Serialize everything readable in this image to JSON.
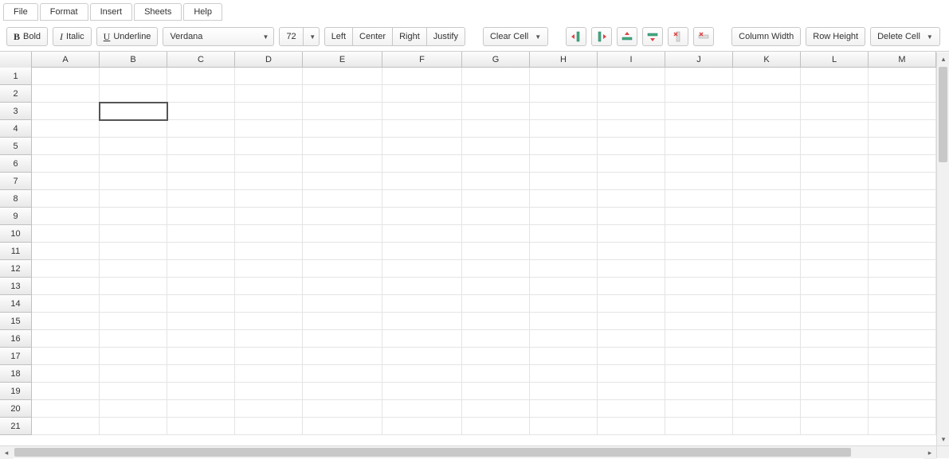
{
  "menu": {
    "items": [
      "File",
      "Format",
      "Insert",
      "Sheets",
      "Help"
    ]
  },
  "toolbar": {
    "bold_label": "Bold",
    "italic_label": "Italic",
    "underline_label": "Underline",
    "font_name": "Verdana",
    "font_size": "72",
    "align": {
      "left": "Left",
      "center": "Center",
      "right": "Right",
      "justify": "Justify"
    },
    "clear_cell": "Clear Cell",
    "column_width": "Column Width",
    "row_height": "Row Height",
    "delete_cell": "Delete Cell"
  },
  "grid": {
    "columns": [
      {
        "label": "A",
        "width": 85
      },
      {
        "label": "B",
        "width": 85
      },
      {
        "label": "C",
        "width": 85
      },
      {
        "label": "D",
        "width": 85
      },
      {
        "label": "E",
        "width": 100
      },
      {
        "label": "F",
        "width": 100
      },
      {
        "label": "G",
        "width": 85
      },
      {
        "label": "H",
        "width": 85
      },
      {
        "label": "I",
        "width": 85
      },
      {
        "label": "J",
        "width": 85
      },
      {
        "label": "K",
        "width": 85
      },
      {
        "label": "L",
        "width": 85
      },
      {
        "label": "M",
        "width": 85
      }
    ],
    "rows": [
      1,
      2,
      3,
      4,
      5,
      6,
      7,
      8,
      9,
      10,
      11,
      12,
      13,
      14,
      15,
      16,
      17,
      18,
      19,
      20,
      21
    ],
    "selected": {
      "row": 3,
      "col": "B"
    }
  }
}
